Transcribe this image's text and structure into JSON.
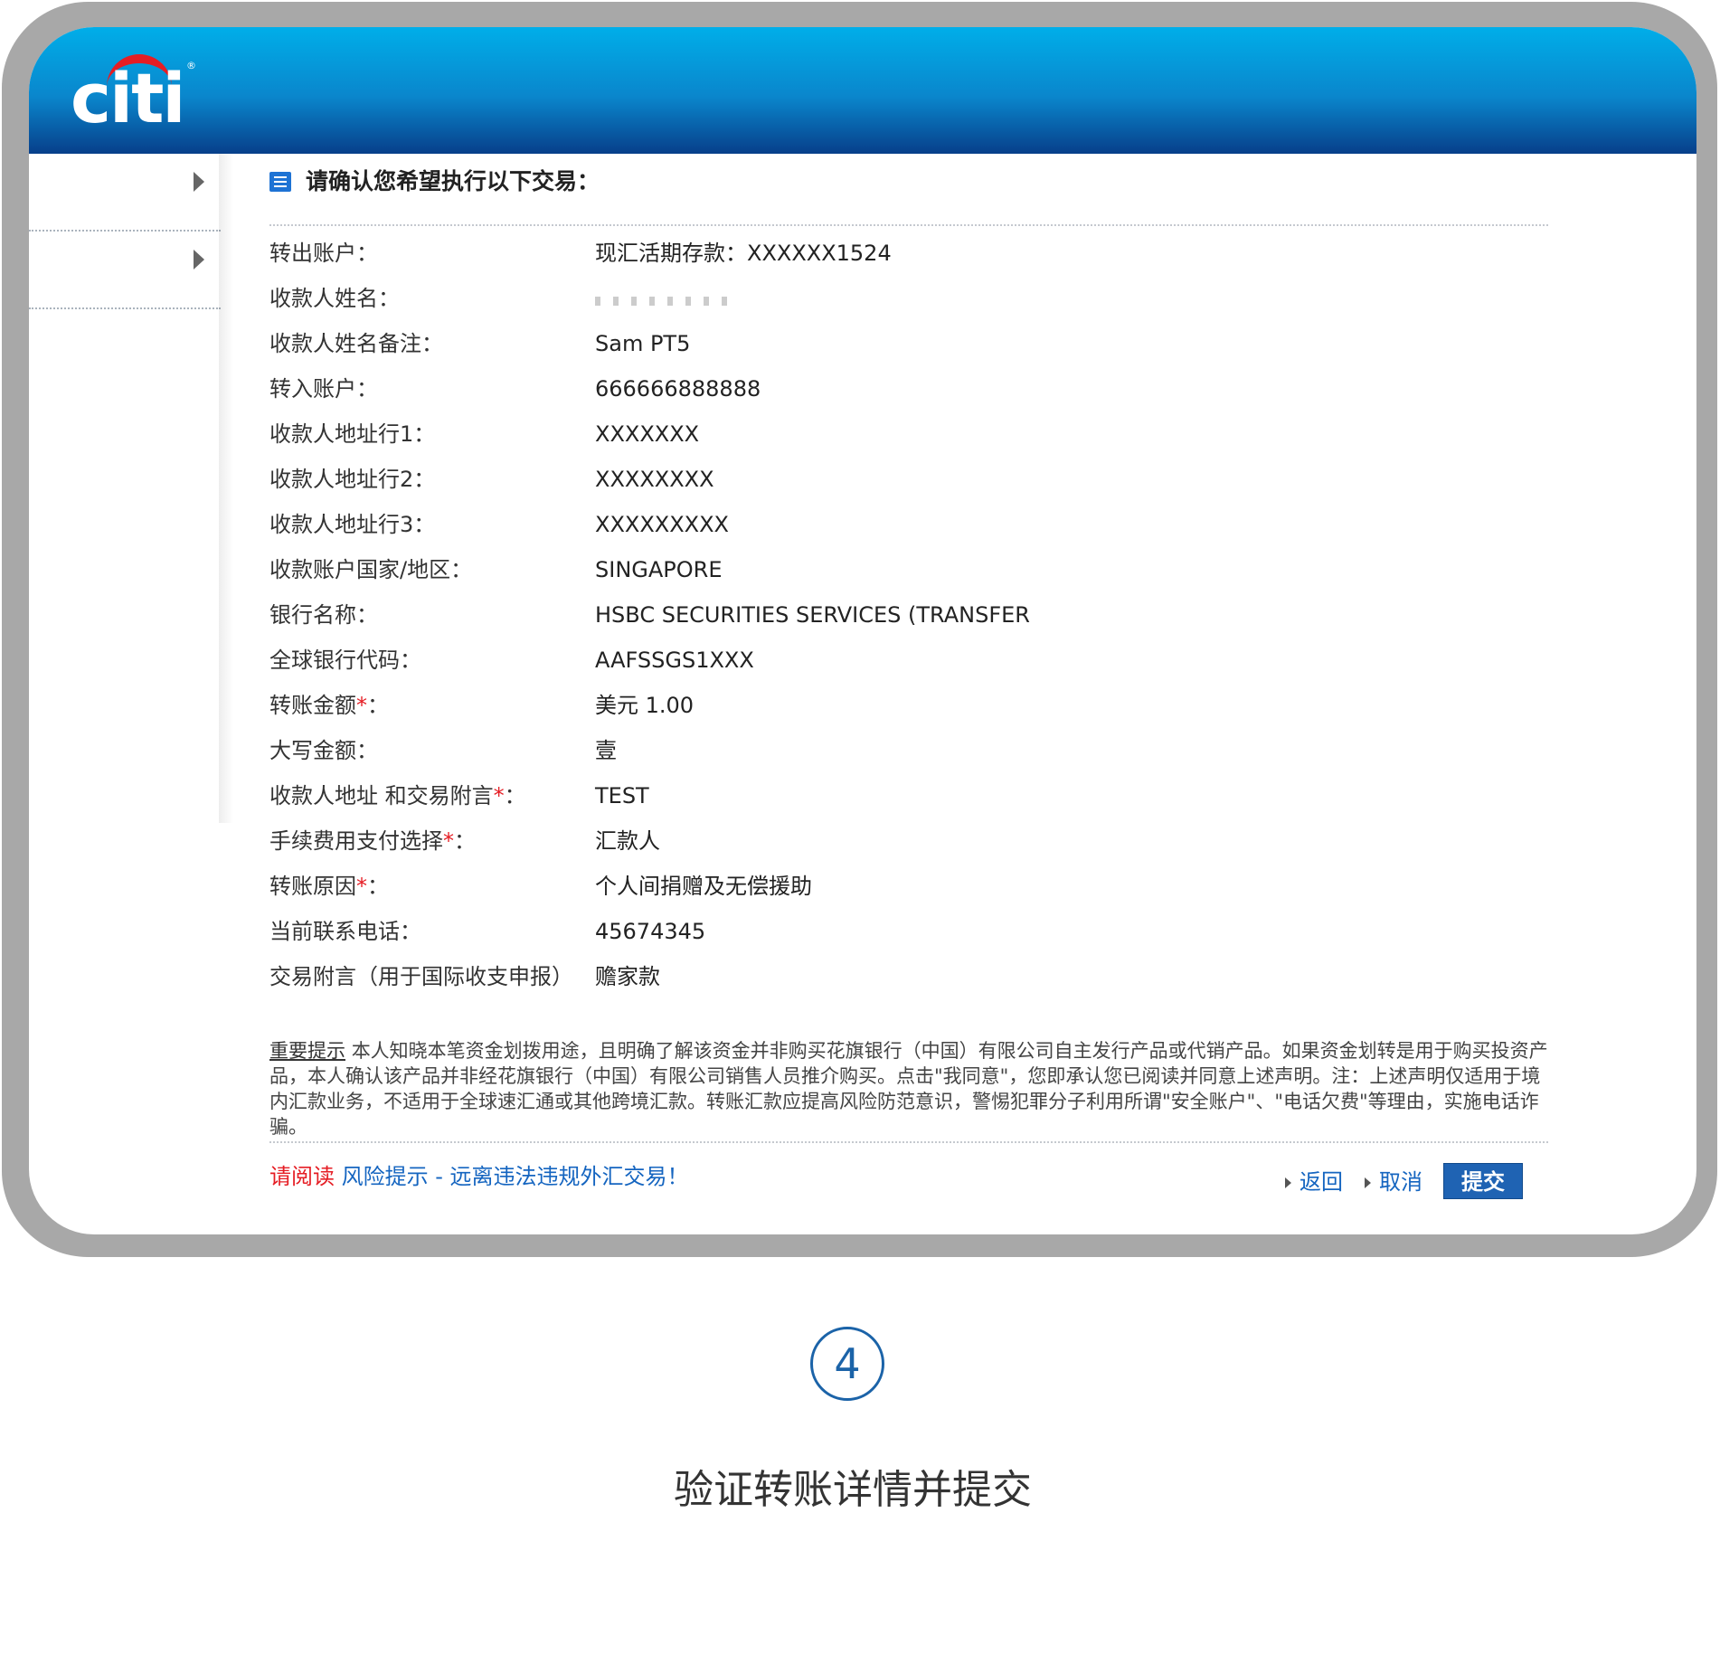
{
  "brand": {
    "logo_text": "citi"
  },
  "confirm_title": "请确认您希望执行以下交易：",
  "fields": [
    {
      "label": "转出账户：",
      "required": false,
      "value": "现汇活期存款：XXXXXX1524"
    },
    {
      "label": "收款人姓名：",
      "required": false,
      "value": ""
    },
    {
      "label": "收款人姓名备注：",
      "required": false,
      "value": "Sam PT5"
    },
    {
      "label": "转入账户：",
      "required": false,
      "value": "666666888888"
    },
    {
      "label": "收款人地址行1：",
      "required": false,
      "value": "XXXXXXX"
    },
    {
      "label": "收款人地址行2：",
      "required": false,
      "value": "XXXXXXXX"
    },
    {
      "label": "收款人地址行3：",
      "required": false,
      "value": "XXXXXXXXX"
    },
    {
      "label": "收款账户国家/地区：",
      "required": false,
      "value": "SINGAPORE"
    },
    {
      "label": "银行名称：",
      "required": false,
      "value": "HSBC SECURITIES SERVICES (TRANSFER"
    },
    {
      "label": "全球银行代码：",
      "required": false,
      "value": "AAFSSGS1XXX"
    },
    {
      "label": "转账金额",
      "required": true,
      "value": "美元 1.00"
    },
    {
      "label": "大写金额：",
      "required": false,
      "value": "壹"
    },
    {
      "label": "收款人地址 和交易附言",
      "required": true,
      "value": "TEST"
    },
    {
      "label": "手续费用支付选择",
      "required": true,
      "value": "汇款人"
    },
    {
      "label": "转账原因",
      "required": true,
      "value": "个人间捐赠及无偿援助"
    },
    {
      "label": "当前联系电话：",
      "required": false,
      "value": "45674345"
    },
    {
      "label": "交易附言（用于国际收支申报）",
      "required": false,
      "value": "赡家款"
    }
  ],
  "required_mark": "*",
  "required_suffix": "：",
  "notice": {
    "label": "重要提示",
    "text": "本人知晓本笔资金划拨用途，且明确了解该资金并非购买花旗银行（中国）有限公司自主发行产品或代销产品。如果资金划转是用于购买投资产品，本人确认该产品并非经花旗银行（中国）有限公司销售人员推介购买。点击\"我同意\"，您即承认您已阅读并同意上述声明。注：上述声明仅适用于境内汇款业务，不适用于全球速汇通或其他跨境汇款。转账汇款应提高风险防范意识，警惕犯罪分子利用所谓\"安全账户\"、\"电话欠费\"等理由，实施电话诈骗。"
  },
  "risk": {
    "prefix": "请阅读",
    "link": "风险提示 - 远离违法违规外汇交易！"
  },
  "actions": {
    "back": "返回",
    "cancel": "取消",
    "submit": "提交"
  },
  "step": {
    "number": "4",
    "caption": "验证转账详情并提交"
  },
  "colors": {
    "header_top": "#00aee9",
    "header_bottom": "#073f8a",
    "link": "#1565c0",
    "required": "#e51d24",
    "submit_bg": "#1f63b3",
    "step": "#1b63a8"
  }
}
